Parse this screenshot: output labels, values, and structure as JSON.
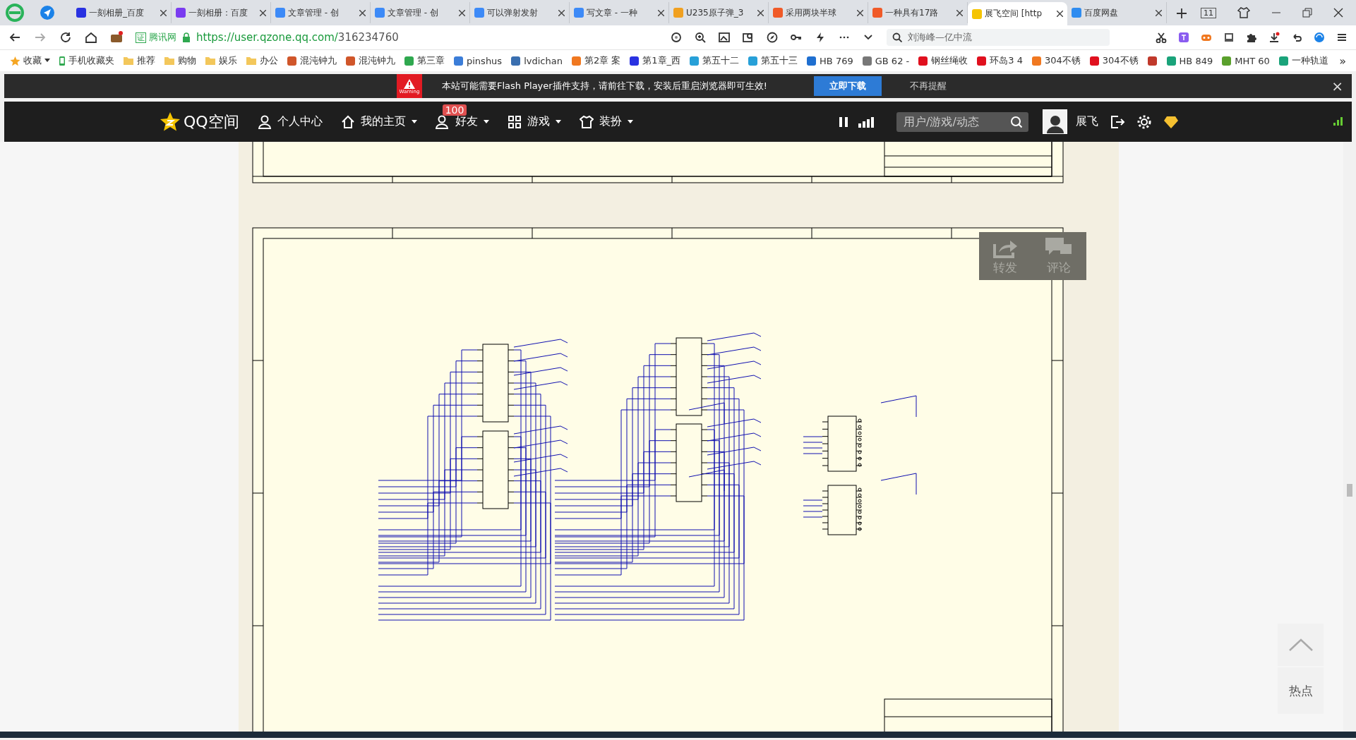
{
  "browser": {
    "tabs": [
      {
        "label": "一刻相册_百度",
        "selected": false,
        "color": "#2932e1"
      },
      {
        "label": "一刻相册：百度",
        "selected": false,
        "color": "#7a3cf0"
      },
      {
        "label": "文章管理 - 创",
        "selected": false,
        "color": "#3d8af7"
      },
      {
        "label": "文章管理 - 创",
        "selected": false,
        "color": "#3d8af7"
      },
      {
        "label": "可以弹射发射",
        "selected": false,
        "color": "#3d8af7"
      },
      {
        "label": "写文章 - 一种",
        "selected": false,
        "color": "#3d8af7"
      },
      {
        "label": "U235原子弹_3",
        "selected": false,
        "color": "#f0a020"
      },
      {
        "label": "采用两块半球",
        "selected": false,
        "color": "#f05a28"
      },
      {
        "label": "一种具有17路",
        "selected": false,
        "color": "#f05a28"
      },
      {
        "label": "展飞空间 [http",
        "selected": true,
        "color": "#f5c400"
      },
      {
        "label": "百度网盘",
        "selected": false,
        "color": "#2f8cf0"
      }
    ],
    "tab_count": "11",
    "address": {
      "badge_mark": "证",
      "badge": "腾讯网",
      "url_host": "https://user.qzone.qq.com/",
      "url_path": "316234760"
    },
    "search": {
      "value": "刘海峰—亿中流"
    },
    "bookmarks": [
      {
        "label": "收藏",
        "kind": "star",
        "color": "#f5a623"
      },
      {
        "label": "手机收藏夹",
        "kind": "phone",
        "color": "#2fa84f"
      },
      {
        "label": "推荐",
        "kind": "folder",
        "color": "#f3c75b"
      },
      {
        "label": "购物",
        "kind": "folder",
        "color": "#f3c75b"
      },
      {
        "label": "娱乐",
        "kind": "folder",
        "color": "#f3c75b"
      },
      {
        "label": "办公",
        "kind": "folder",
        "color": "#f3c75b"
      },
      {
        "label": "混沌钟九",
        "kind": "site",
        "color": "#d0562a"
      },
      {
        "label": "混沌钟九",
        "kind": "site",
        "color": "#d0562a"
      },
      {
        "label": "第三章",
        "kind": "site",
        "color": "#2fa84f"
      },
      {
        "label": "pinshus",
        "kind": "site",
        "color": "#3b7dd8"
      },
      {
        "label": "lvdichan",
        "kind": "site",
        "color": "#3a6fb0"
      },
      {
        "label": "第2章 案",
        "kind": "site",
        "color": "#f07820"
      },
      {
        "label": "第1章_西",
        "kind": "site",
        "color": "#2932e1"
      },
      {
        "label": "第五十二",
        "kind": "site",
        "color": "#27a0d8"
      },
      {
        "label": "第五十三",
        "kind": "site",
        "color": "#27a0d8"
      },
      {
        "label": "HB 769",
        "kind": "site",
        "color": "#1f6fd0"
      },
      {
        "label": "GB 62 -",
        "kind": "site",
        "color": "#777777"
      },
      {
        "label": "钢丝绳收",
        "kind": "site",
        "color": "#e0101e"
      },
      {
        "label": "环岛3 4",
        "kind": "site",
        "color": "#e0101e"
      },
      {
        "label": "304不锈",
        "kind": "site",
        "color": "#f07820"
      },
      {
        "label": "304不锈",
        "kind": "site",
        "color": "#e0101e"
      },
      {
        "kind": "site",
        "color": "#c0392b"
      },
      {
        "label": "HB 849",
        "kind": "site",
        "color": "#1aa37a"
      },
      {
        "label": "MHT 60",
        "kind": "site",
        "color": "#5aa02c"
      },
      {
        "label": "一种轨道",
        "kind": "site",
        "color": "#1aa37a"
      }
    ],
    "bookmarks_more": "»"
  },
  "flash_bar": {
    "warning_label": "Warning",
    "message": "本站可能需要Flash Player插件支持，请前往下载，安装后重启浏览器即可生效!",
    "download_button": "立即下载",
    "dismiss_link": "不再提醒",
    "close": "×"
  },
  "nav": {
    "logo": "QQ空间",
    "items": [
      {
        "label": "个人中心",
        "kind": "person",
        "dropdown": false
      },
      {
        "label": "我的主页",
        "kind": "home",
        "dropdown": true
      },
      {
        "label": "好友",
        "kind": "friends",
        "dropdown": true,
        "badge": "100"
      },
      {
        "label": "游戏",
        "kind": "grid",
        "dropdown": true
      },
      {
        "label": "装扮",
        "kind": "shirt",
        "dropdown": true
      }
    ],
    "search": {
      "placeholder": "用户/游戏/动态"
    },
    "user": "展飞"
  },
  "share_overlay": {
    "buttons": [
      {
        "label": "转发",
        "kind": "share"
      },
      {
        "label": "评论",
        "kind": "comment"
      }
    ]
  },
  "side_tools": {
    "label": "热点"
  }
}
